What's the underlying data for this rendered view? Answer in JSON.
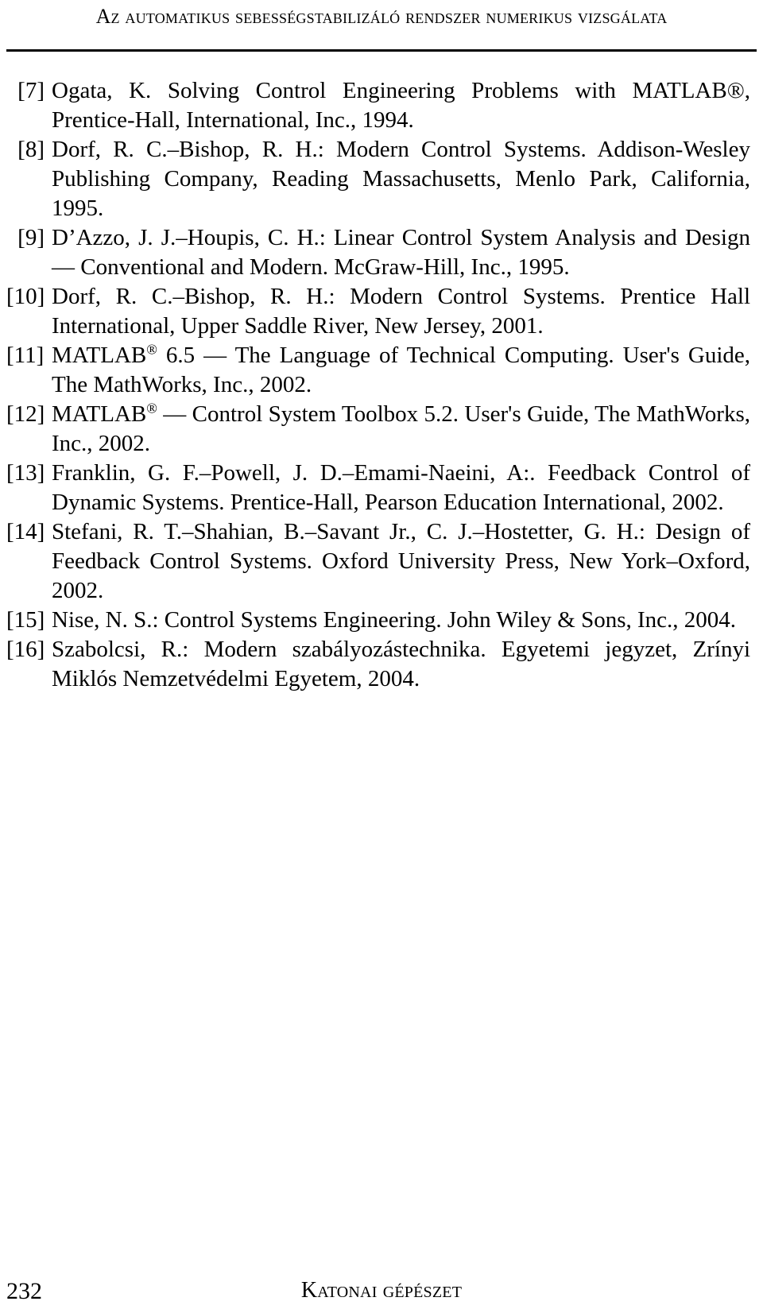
{
  "header": {
    "running_head": "Az automatikus sebességstabilizáló rendszer numerikus vizsgálata"
  },
  "references": [
    {
      "label": "[7]",
      "text_before_mark": "Ogata, K. Solving Control Engineering Problems with MATLAB",
      "mark": "®",
      "text_after_mark": ", Prentice-Hall, International, Inc., 1994."
    },
    {
      "label": "[8]",
      "text": "Dorf, R. C.–Bishop, R. H.: Modern Control Systems. Addison-Wesley Publishing Company, Reading Massachusetts, Menlo Park, California, 1995."
    },
    {
      "label": "[9]",
      "text": "D’Azzo, J. J.–Houpis, C. H.: Linear Control System Analysis and Design — Conventional and Modern. McGraw-Hill, Inc., 1995."
    },
    {
      "label": "[10]",
      "text": "Dorf, R. C.–Bishop, R. H.: Modern Control Systems. Prentice Hall International, Upper Saddle River, New Jersey, 2001."
    },
    {
      "label": "[11]",
      "text_before_mark": "MATLAB",
      "mark": "®",
      "text_after_mark": " 6.5 — The Language of Technical Computing. User's Guide, The MathWorks, Inc., 2002."
    },
    {
      "label": "[12]",
      "text_before_mark": "MATLAB",
      "mark": "®",
      "text_after_mark": " — Control System Toolbox 5.2. User's Guide, The MathWorks, Inc., 2002."
    },
    {
      "label": "[13]",
      "text": "Franklin, G. F.–Powell, J. D.–Emami-Naeini, A:. Feedback Control of Dynamic Systems. Prentice-Hall, Pearson Education International, 2002."
    },
    {
      "label": "[14]",
      "text": "Stefani, R. T.–Shahian, B.–Savant Jr., C. J.–Hostetter, G. H.: Design of Feedback Control Systems. Oxford University Press, New York–Oxford, 2002."
    },
    {
      "label": "[15]",
      "text": "Nise, N. S.: Control Systems Engineering. John Wiley & Sons, Inc., 2004."
    },
    {
      "label": "[16]",
      "text": "Szabolcsi, R.: Modern szabályozástechnika. Egyetemi jegyzet, Zrínyi Miklós Nemzetvédelmi Egyetem, 2004."
    }
  ],
  "footer": {
    "page_number": "232",
    "journal_title": "Katonai gépészet"
  }
}
